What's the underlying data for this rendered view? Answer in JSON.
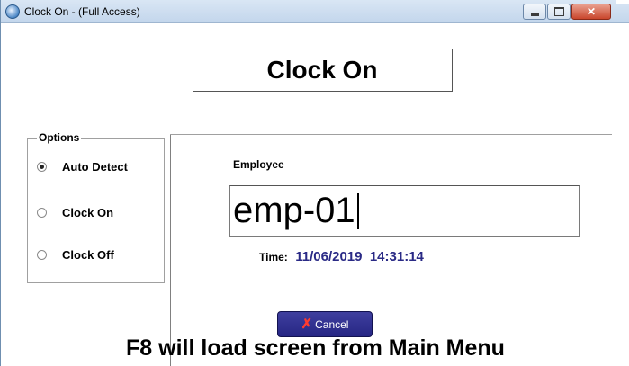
{
  "window": {
    "title": "Clock On - (Full Access)",
    "icon": "app-globe-icon",
    "controls": {
      "minimize_icon": "minimize-icon",
      "maximize_icon": "maximize-icon",
      "close_icon": "close-icon",
      "close_glyph": "✕"
    }
  },
  "heading": "Clock On",
  "options": {
    "legend": "Options",
    "items": [
      {
        "label": "Auto Detect",
        "checked": true
      },
      {
        "label": "Clock On",
        "checked": false
      },
      {
        "label": "Clock Off",
        "checked": false
      }
    ]
  },
  "employee": {
    "label": "Employee",
    "value": "emp-01"
  },
  "time": {
    "label": "Time:",
    "value": "11/06/2019  14:31:14"
  },
  "cancel_button": {
    "label": "Cancel",
    "icon": "x-icon",
    "icon_glyph": "✗",
    "color": "#2b2b8a"
  },
  "footer": "F8 will load screen from Main Menu",
  "colors": {
    "time_value": "#2a2a86",
    "titlebar": "#c9dbef",
    "close_button": "#c9462c"
  }
}
